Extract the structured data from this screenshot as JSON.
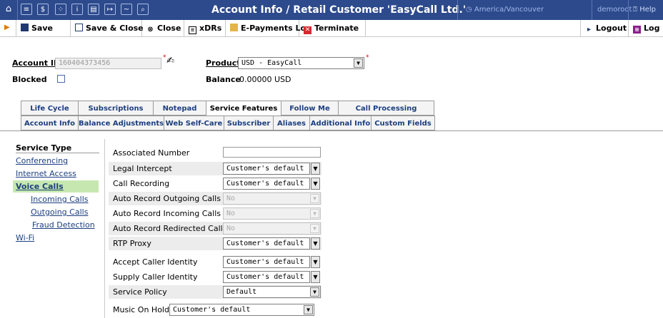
{
  "titlebar": {
    "title": "Account Info / Retail Customer 'EasyCall Ltd.'",
    "timezone": "America/Vancouver",
    "user": "demoroot",
    "help": "Help"
  },
  "toolbar": {
    "save": "Save",
    "save_close": "Save & Close",
    "close": "Close",
    "xdrs": "xDRs",
    "epayments": "E-Payments Log",
    "terminate": "Terminate",
    "logout": "Logout",
    "log": "Log"
  },
  "header": {
    "account_id_label": "Account ID",
    "account_id_value": "160404373456",
    "product_label": "Product",
    "product_value": "USD - EasyCall",
    "blocked_label": "Blocked",
    "balance_label": "Balance",
    "balance_value": "0.00000 USD"
  },
  "tabs_row1": [
    "Life Cycle",
    "Subscriptions",
    "Notepad",
    "Service Features",
    "Follow Me",
    "Call Processing"
  ],
  "tabs_row2": [
    "Account Info",
    "Balance Adjustments",
    "Web Self-Care",
    "Subscriber",
    "Aliases",
    "Additional Info",
    "Custom Fields"
  ],
  "sidebar": {
    "heading": "Service Type",
    "items": [
      "Conferencing",
      "Internet Access",
      "Voice Calls",
      "Incoming Calls",
      "Outgoing Calls",
      "Fraud Detection",
      "Wi-Fi"
    ]
  },
  "rows": [
    {
      "label": "Associated Number",
      "value": ""
    },
    {
      "label": "Legal Intercept",
      "value": "Customer's default"
    },
    {
      "label": "Call Recording",
      "value": "Customer's default"
    },
    {
      "label": "Auto Record Outgoing Calls",
      "value": "No"
    },
    {
      "label": "Auto Record Incoming Calls",
      "value": "No"
    },
    {
      "label": "Auto Record Redirected Calls",
      "value": "No"
    },
    {
      "label": "RTP Proxy",
      "value": "Customer's default"
    },
    {
      "label": "Accept Caller Identity",
      "value": "Customer's default"
    },
    {
      "label": "Supply Caller Identity",
      "value": "Customer's default"
    },
    {
      "label": "Service Policy",
      "value": "Default"
    },
    {
      "label": "Music On Hold",
      "value": "Customer's default"
    }
  ]
}
